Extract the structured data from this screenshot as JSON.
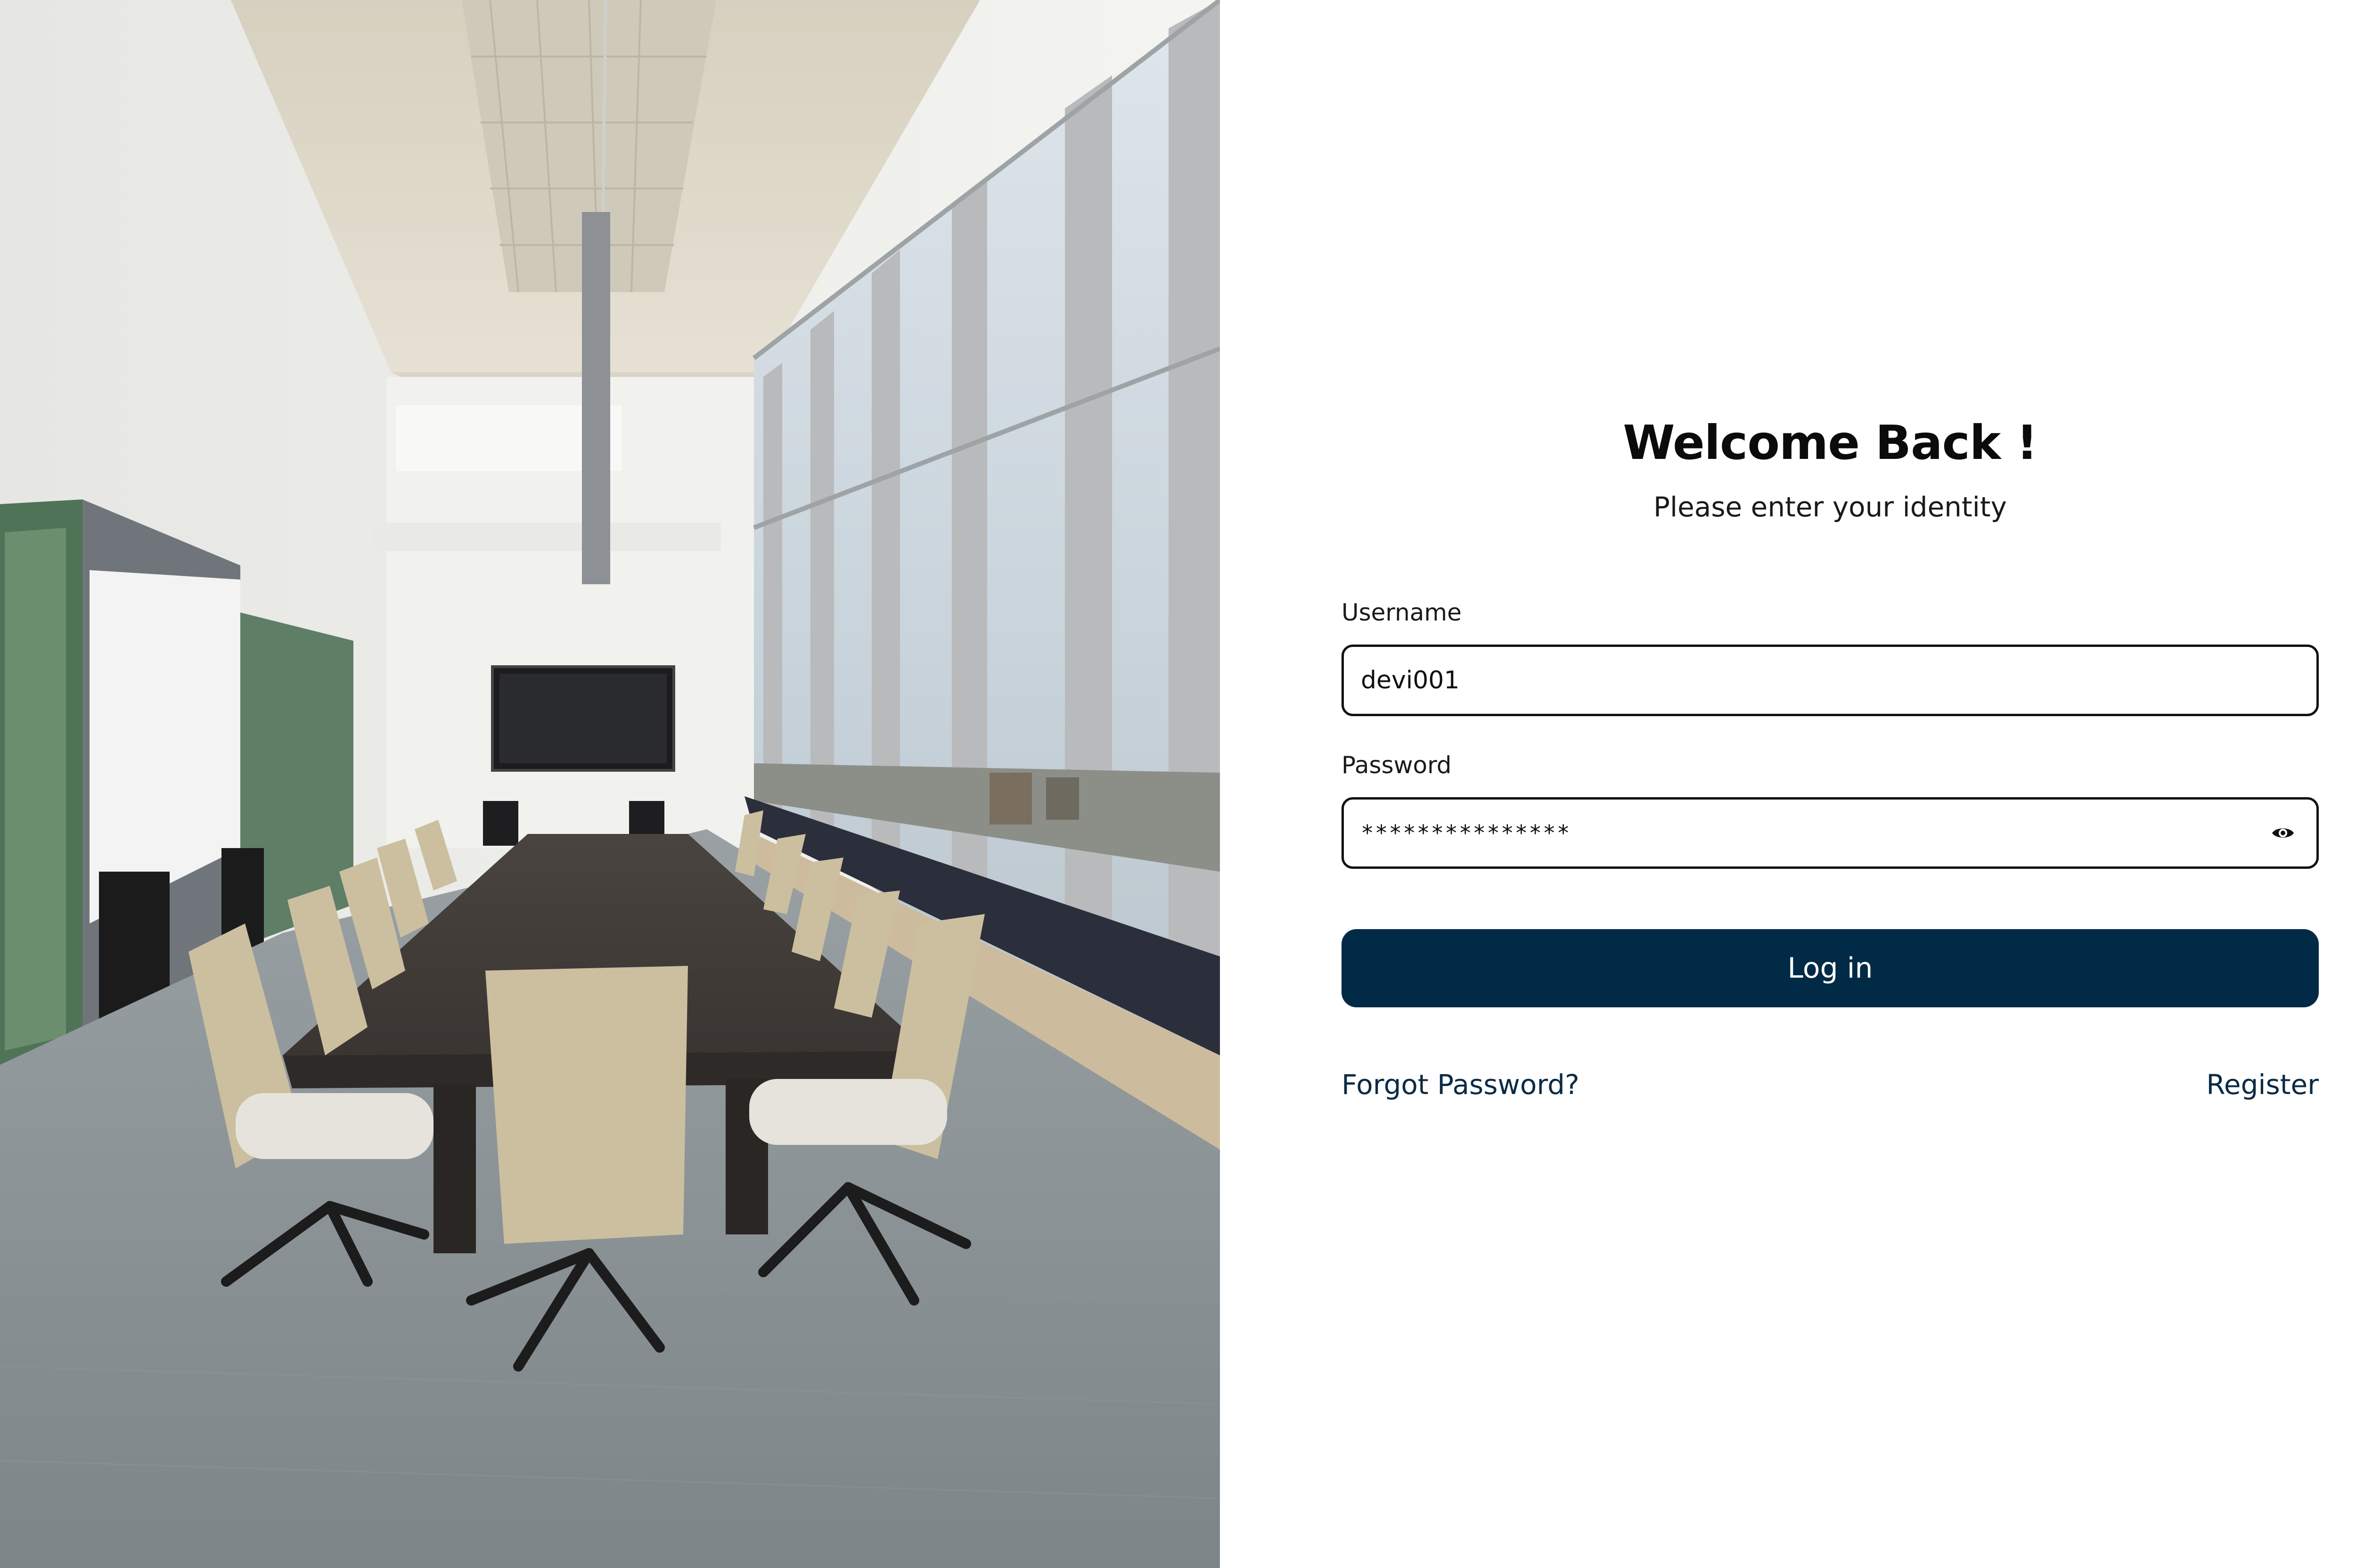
{
  "login": {
    "title": "Welcome Back !",
    "subtitle": "Please enter your identity",
    "username": {
      "label": "Username",
      "value": "devi001"
    },
    "password": {
      "label": "Password",
      "value": "***************"
    },
    "login_button_label": "Log in",
    "forgot_password_label": "Forgot Password?",
    "register_label": "Register"
  },
  "icons": {
    "password_toggle": "eye-icon"
  },
  "colors": {
    "primary": "#002a45",
    "link": "#0b2a44",
    "border": "#111111",
    "title": "#0b0b0b"
  }
}
